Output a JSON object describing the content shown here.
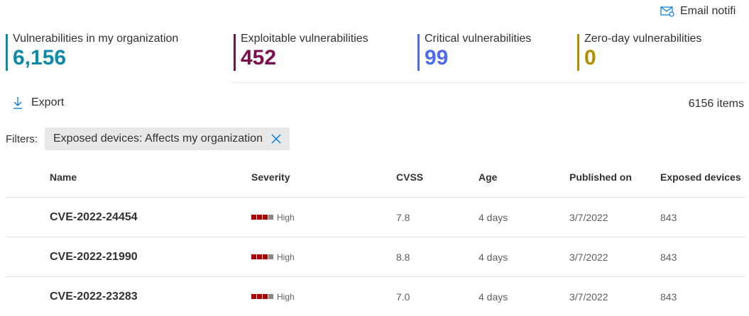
{
  "header": {
    "email_label": "Email notifi"
  },
  "kpis": [
    {
      "label": "Vulnerabilities in my organization",
      "value": "6,156",
      "color": "#0e8aa8"
    },
    {
      "label": "Exploitable vulnerabilities",
      "value": "452",
      "color": "#7a0e4f"
    },
    {
      "label": "Critical vulnerabilities",
      "value": "99",
      "color": "#4f6bed"
    },
    {
      "label": "Zero-day vulnerabilities",
      "value": "0",
      "color": "#b38f00"
    }
  ],
  "toolbar": {
    "export_label": "Export",
    "items_count": "6156 items"
  },
  "filters": {
    "label": "Filters:",
    "pill": "Exposed devices: Affects my organization"
  },
  "table": {
    "columns": [
      "Name",
      "Severity",
      "CVSS",
      "Age",
      "Published on",
      "Exposed devices"
    ],
    "rows": [
      {
        "name": "CVE-2022-24454",
        "severity": "High",
        "severity_level": 3,
        "cvss": "7.8",
        "age": "4 days",
        "published": "3/7/2022",
        "exposed": "843"
      },
      {
        "name": "CVE-2022-21990",
        "severity": "High",
        "severity_level": 3,
        "cvss": "8.8",
        "age": "4 days",
        "published": "3/7/2022",
        "exposed": "843"
      },
      {
        "name": "CVE-2022-23283",
        "severity": "High",
        "severity_level": 3,
        "cvss": "7.0",
        "age": "4 days",
        "published": "3/7/2022",
        "exposed": "843"
      }
    ]
  },
  "colors": {
    "severity_filled": "#a80000",
    "severity_empty": "#8a8886",
    "accent": "#0078d4"
  },
  "icons": {
    "email": "mail-settings-icon",
    "export": "download-arrow-icon",
    "remove_filter": "close-icon"
  }
}
